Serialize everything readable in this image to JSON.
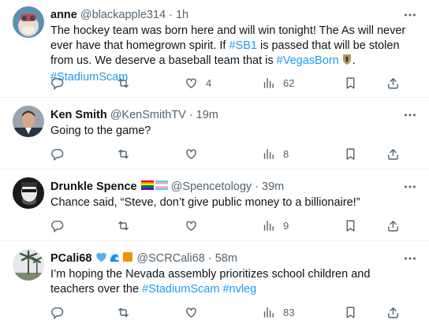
{
  "tweets": [
    {
      "name": "anne",
      "handle": "@blackapple314",
      "separator": "·",
      "time": "1h",
      "text": [
        {
          "t": "The hockey team was born here and will win tonight! The As will never ever have that homegrown spirit. If ",
          "tag": false
        },
        {
          "t": "#SB1",
          "tag": true
        },
        {
          "t": " is passed that will be stolen from us. We deserve a baseball team that is ",
          "tag": false
        },
        {
          "t": "#VegasBorn",
          "tag": true
        },
        {
          "t": "[golden-knights-icon]",
          "icon": true
        },
        {
          "t": ". ",
          "tag": false
        },
        {
          "t": "#StadiumScam",
          "tag": true
        }
      ],
      "replies": "",
      "retweets": "",
      "likes": "4",
      "views": "62"
    },
    {
      "name": "Ken Smith",
      "handle": "@KenSmithTV",
      "separator": "·",
      "time": "19m",
      "text": [
        {
          "t": "Going to the game?",
          "tag": false
        }
      ],
      "replies": "",
      "retweets": "",
      "likes": "",
      "views": "8"
    },
    {
      "name": "Drunkle Spence",
      "name_badges": [
        "rainbow-flag-icon",
        "trans-flag-icon"
      ],
      "handle": "@Spencetology",
      "separator": "·",
      "time": "39m",
      "text": [
        {
          "t": "Chance said, “Steve, don’t give public money to a billionaire!”",
          "tag": false
        }
      ],
      "replies": "",
      "retweets": "",
      "likes": "",
      "views": "9"
    },
    {
      "name": "PCali68",
      "name_badges": [
        "blue-heart-icon",
        "wave-icon",
        "orange-square-icon"
      ],
      "handle": "@SCRCali68",
      "separator": "·",
      "time": "58m",
      "text": [
        {
          "t": "I’m hoping the Nevada assembly prioritizes school children and teachers over the ",
          "tag": false
        },
        {
          "t": "#StadiumScam",
          "tag": true
        },
        {
          "t": " ",
          "tag": false
        },
        {
          "t": "#nvleg",
          "tag": true
        }
      ],
      "replies": "",
      "retweets": "",
      "likes": "",
      "views": "83"
    }
  ],
  "colors": {
    "text": "#0f1419",
    "muted": "#536471",
    "link": "#1d9bf0",
    "divider": "#eff3f4"
  }
}
